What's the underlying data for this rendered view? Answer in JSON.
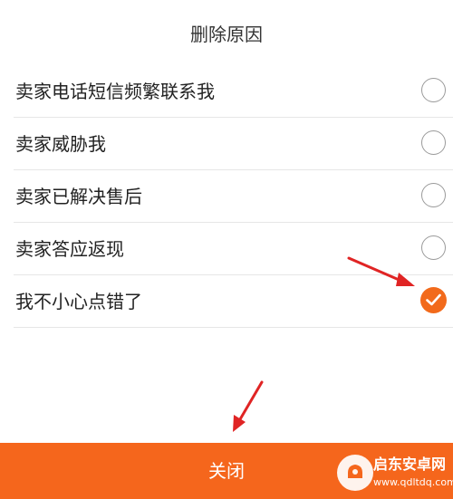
{
  "dialog": {
    "title": "删除原因",
    "options": [
      {
        "label": "卖家电话短信频繁联系我",
        "checked": false
      },
      {
        "label": "卖家威胁我",
        "checked": false
      },
      {
        "label": "卖家已解决售后",
        "checked": false
      },
      {
        "label": "卖家答应返现",
        "checked": false
      },
      {
        "label": "我不小心点错了",
        "checked": true
      }
    ],
    "close_label": "关闭"
  },
  "colors": {
    "accent": "#f5661c",
    "arrow": "#e02424",
    "radio_border": "#9a9a9a"
  },
  "watermark": {
    "name": "启东安卓网",
    "url": "www.qdltdq.com"
  }
}
